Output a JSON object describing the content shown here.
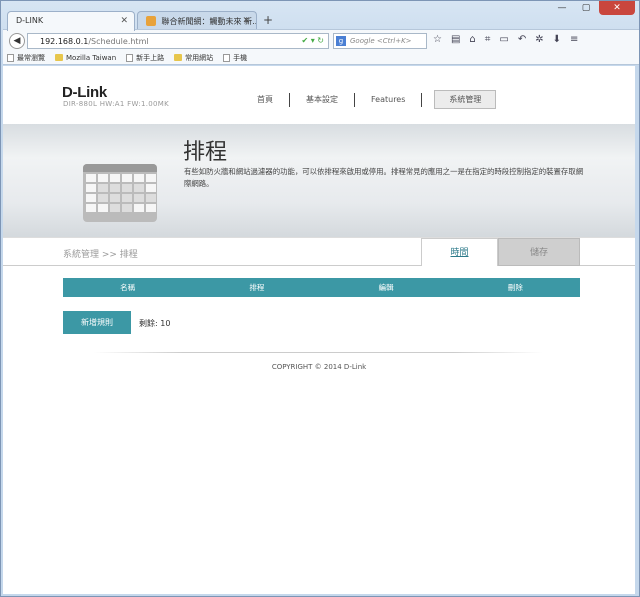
{
  "browser": {
    "tabs": [
      {
        "label": "D-LINK"
      },
      {
        "label": "聯合新聞網：觸動未來 新..."
      }
    ],
    "url_host": "192.168.0.1",
    "url_path": "/Schedule.html",
    "search_placeholder": "Google <Ctrl+K>",
    "bookmarks": [
      {
        "label": "最常瀏覽",
        "icon": "page-icon"
      },
      {
        "label": "Mozilla Taiwan",
        "icon": "folder-icon"
      },
      {
        "label": "新手上路",
        "icon": "page-icon"
      },
      {
        "label": "常用網站",
        "icon": "folder-icon"
      },
      {
        "label": "手機",
        "icon": "page-icon"
      }
    ]
  },
  "header": {
    "logo": "D-Link",
    "model": "DIR-880L   HW:A1   FW:1.00MK",
    "nav": [
      {
        "label": "首頁"
      },
      {
        "label": "基本設定"
      },
      {
        "label": "Features"
      },
      {
        "label": "系統管理"
      }
    ]
  },
  "banner": {
    "title": "排程",
    "description": "有些如防火牆和網站過濾器的功能，可以依排程來啟用或停用。排程常見的應用之一是在指定的時段控制指定的裝置存取網際網路。"
  },
  "breadcrumb": "系統管理 >> 排程",
  "buttons": {
    "time": "時間",
    "save": "儲存",
    "add_rule": "新增規則"
  },
  "table": {
    "headers": [
      "名稱",
      "排程",
      "編輯",
      "刪除"
    ]
  },
  "remaining": "剩餘: 10",
  "footer": "COPYRIGHT © 2014 D-Link"
}
